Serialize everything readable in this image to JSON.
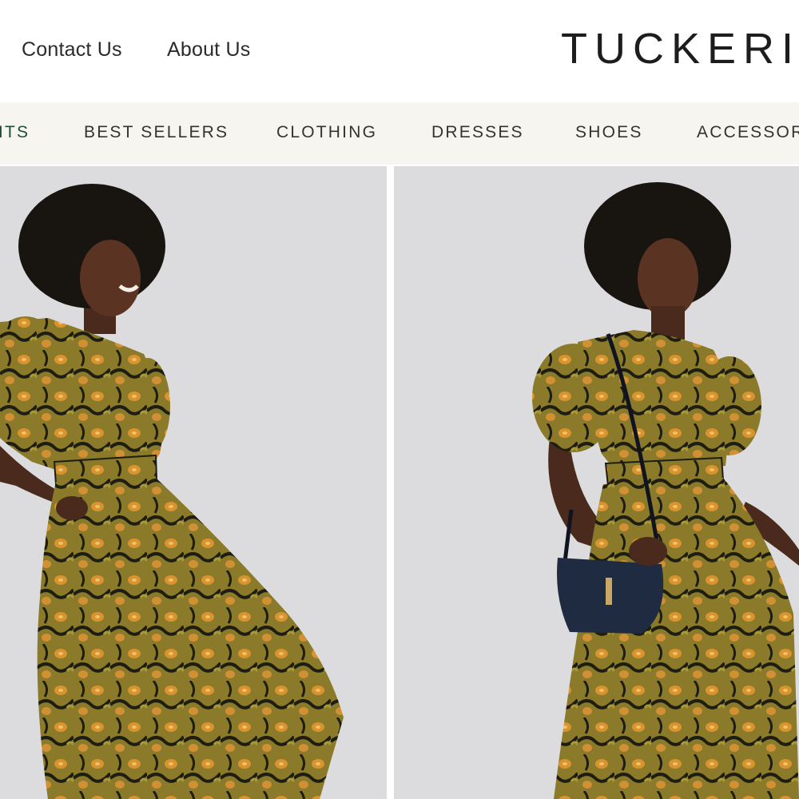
{
  "header": {
    "links": [
      {
        "label": "Contact Us"
      },
      {
        "label": "About Us"
      }
    ],
    "brand": "TUCKERI"
  },
  "nav": {
    "items": [
      {
        "label": "ITS"
      },
      {
        "label": "BEST SELLERS"
      },
      {
        "label": "CLOTHING"
      },
      {
        "label": "DRESSES"
      },
      {
        "label": "SHOES"
      },
      {
        "label": "ACCESSOR"
      }
    ]
  },
  "products": [
    {
      "image": "model-in-floral-smocked-midi-dress"
    },
    {
      "image": "model-in-floral-smocked-midi-dress-with-navy-crossbody-bag"
    }
  ],
  "colors": {
    "nav_background": "#f7f5f0",
    "active_nav": "#1f4d3b",
    "photo_background": "#dcdcde",
    "dress_olive": "#8a7a2a",
    "dress_flower": "#d9942f",
    "bag_navy": "#1f2b40"
  }
}
